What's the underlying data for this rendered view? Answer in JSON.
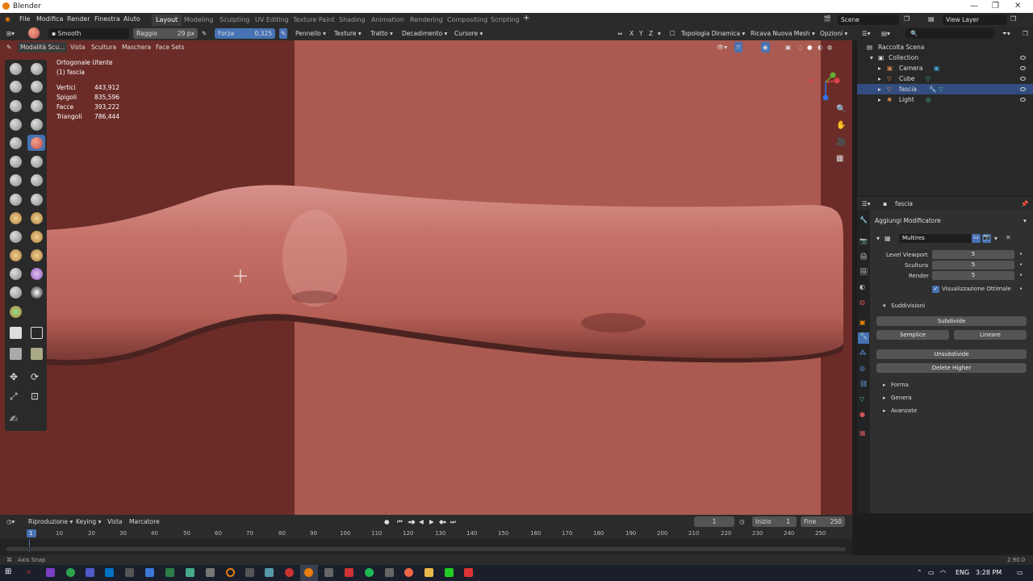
{
  "titlebar": {
    "title": "Blender"
  },
  "menubar": {
    "items": [
      "File",
      "Modifica",
      "Render",
      "Finestra",
      "Aiuto"
    ],
    "workspaces": [
      "Layout",
      "Modeling",
      "Sculpting",
      "UV Editing",
      "Texture Paint",
      "Shading",
      "Animation",
      "Rendering",
      "Compositing",
      "Scripting"
    ],
    "add_tab": "+",
    "scene": "Scene",
    "view_layer": "View Layer"
  },
  "tool_header": {
    "brush": "Smooth",
    "radius_label": "Raggio",
    "radius_value": "29 px",
    "strength_label": "Forza",
    "strength_value": "0.325",
    "menus": [
      "Pennello",
      "Texture",
      "Tratto",
      "Decadimento",
      "Cursore"
    ],
    "axes": [
      "X",
      "Y",
      "Z"
    ],
    "dyntopo": "Topologia Dinamica",
    "remesh": "Ricava Nuova Mesh",
    "options": "Opzioni"
  },
  "viewport_header": {
    "mode": "Modalità Scu...",
    "menus": [
      "Vista",
      "Scultura",
      "Maschera",
      "Face Sets"
    ]
  },
  "viewport": {
    "view_name": "Ortogonale Utente",
    "object_name": "(1) fascia",
    "stats": [
      {
        "label": "Vertici",
        "value": "443,912"
      },
      {
        "label": "Spigoli",
        "value": "835,596"
      },
      {
        "label": "Facce",
        "value": "393,222"
      },
      {
        "label": "Triangoli",
        "value": "786,444"
      }
    ]
  },
  "outliner": {
    "root": "Raccolta Scena",
    "items": [
      {
        "name": "Collection",
        "selected": false
      },
      {
        "name": "Camera",
        "selected": false
      },
      {
        "name": "Cube",
        "selected": false
      },
      {
        "name": "fascia",
        "selected": true
      },
      {
        "name": "Light",
        "selected": false
      }
    ]
  },
  "properties": {
    "object_name": "fascia",
    "add_modifier": "Aggiungi Modificatore",
    "modifier_name": "Multires",
    "fields": [
      {
        "label": "Level Viewport",
        "value": "5"
      },
      {
        "label": "Scultura",
        "value": "5"
      },
      {
        "label": "Render",
        "value": "5"
      }
    ],
    "optimal_display": "Visualizzazione Ottimale",
    "subdivisions_header": "Suddivisioni",
    "subdivide": "Subdivide",
    "simple": "Semplice",
    "linear": "Lineare",
    "unsubdivide": "Unsubdivide",
    "delete_higher": "Delete Higher",
    "sections": [
      "Forma",
      "Genera",
      "Avanzate"
    ]
  },
  "timeline": {
    "menus": [
      "Riproduzione",
      "Keying",
      "Vista",
      "Marcatore"
    ],
    "current_frame": "1",
    "start_label": "Inizio",
    "start_value": "1",
    "end_label": "Fine",
    "end_value": "250",
    "ticks": [
      "1",
      "10",
      "20",
      "30",
      "40",
      "50",
      "60",
      "70",
      "80",
      "90",
      "100",
      "110",
      "120",
      "130",
      "140",
      "150",
      "160",
      "170",
      "180",
      "190",
      "200",
      "210",
      "220",
      "230",
      "240",
      "250"
    ]
  },
  "statusbar": {
    "hint": "Axis Snap",
    "version": "2.90.0"
  },
  "taskbar": {
    "lang": "ENG",
    "time": "3:28 PM"
  },
  "colors": {
    "accent": "#4772b3",
    "skin": "#aa5a50",
    "skin_dark": "#6b2c27"
  }
}
